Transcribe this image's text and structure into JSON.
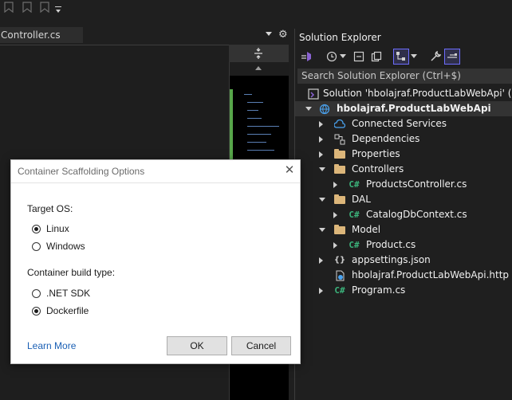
{
  "editor": {
    "tab_label": "Controller.cs"
  },
  "solution_explorer": {
    "title": "Solution Explorer",
    "search_placeholder": "Search Solution Explorer (Ctrl+$)",
    "tree": [
      {
        "label": "Solution 'hbolajraf.ProductLabWebApi' (1 of",
        "icon": "solution-icon",
        "level": 0,
        "expander": "none"
      },
      {
        "label": "hbolajraf.ProductLabWebApi",
        "icon": "web-project-icon",
        "level": 0,
        "expander": "down",
        "selected": true
      },
      {
        "label": "Connected Services",
        "icon": "connected-services-icon",
        "level": 1,
        "expander": "right"
      },
      {
        "label": "Dependencies",
        "icon": "dependencies-icon",
        "level": 1,
        "expander": "right"
      },
      {
        "label": "Properties",
        "icon": "properties-folder-icon",
        "level": 1,
        "expander": "right"
      },
      {
        "label": "Controllers",
        "icon": "folder-icon",
        "level": 1,
        "expander": "down"
      },
      {
        "label": "ProductsController.cs",
        "icon": "csharp-file-icon",
        "level": 2,
        "expander": "right"
      },
      {
        "label": "DAL",
        "icon": "folder-icon",
        "level": 1,
        "expander": "down"
      },
      {
        "label": "CatalogDbContext.cs",
        "icon": "csharp-file-icon",
        "level": 2,
        "expander": "right"
      },
      {
        "label": "Model",
        "icon": "folder-icon",
        "level": 1,
        "expander": "down"
      },
      {
        "label": "Product.cs",
        "icon": "csharp-file-icon",
        "level": 2,
        "expander": "right"
      },
      {
        "label": "appsettings.json",
        "icon": "json-file-icon",
        "level": 1,
        "expander": "right"
      },
      {
        "label": "hbolajraf.ProductLabWebApi.http",
        "icon": "http-file-icon",
        "level": 1,
        "expander": "none"
      },
      {
        "label": "Program.cs",
        "icon": "csharp-file-icon",
        "level": 1,
        "expander": "right"
      }
    ]
  },
  "dialog": {
    "title": "Container Scaffolding Options",
    "target_os_label": "Target OS:",
    "os_options": [
      {
        "label": "Linux",
        "checked": true
      },
      {
        "label": "Windows",
        "checked": false
      }
    ],
    "build_type_label": "Container build type:",
    "build_options": [
      {
        "label": ".NET SDK",
        "checked": false
      },
      {
        "label": "Dockerfile",
        "checked": true
      }
    ],
    "learn_more": "Learn More",
    "ok_label": "OK",
    "cancel_label": "Cancel"
  },
  "colors": {
    "accent": "#6d6dff",
    "link": "#1a5fb4",
    "csharp": "#3bb37b",
    "folder": "#dcb67a"
  }
}
